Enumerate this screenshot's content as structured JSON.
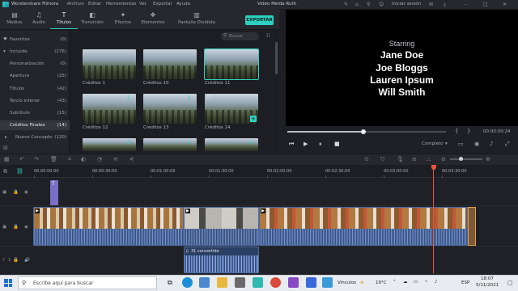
{
  "menubar": {
    "app_name": "Wondershare Filmora",
    "menus": [
      "Archivo",
      "Editar",
      "Herramientas",
      "Ver",
      "Exportar",
      "Ayuda"
    ],
    "project_title": "Video Melda Ruth",
    "login_label": "Iniciar sesión"
  },
  "tabs": [
    {
      "label": "Medios",
      "icon": "folder-icon",
      "glyph": "▤"
    },
    {
      "label": "Audio",
      "icon": "music-note-icon",
      "glyph": "♫"
    },
    {
      "label": "Títulos",
      "icon": "title-text-icon",
      "glyph": "T"
    },
    {
      "label": "Transición",
      "icon": "transition-icon",
      "glyph": "◧"
    },
    {
      "label": "Efectos",
      "icon": "effects-icon",
      "glyph": "✦"
    },
    {
      "label": "Elementos",
      "icon": "elements-icon",
      "glyph": "❖"
    },
    {
      "label": "Pantalla Dividida",
      "icon": "split-screen-icon",
      "glyph": "▥"
    }
  ],
  "export_label": "EXPORTAR",
  "search": {
    "placeholder": "Buscar"
  },
  "sidebar": {
    "items": [
      {
        "label": "Favoritos",
        "count": "(0)",
        "prefix": "♥"
      },
      {
        "label": "Incluido",
        "count": "(276)",
        "prefix": "▾"
      },
      {
        "label": "Personalización",
        "count": "(0)",
        "prefix": ""
      },
      {
        "label": "Apertura",
        "count": "(25)",
        "prefix": ""
      },
      {
        "label": "Títulos",
        "count": "(42)",
        "prefix": ""
      },
      {
        "label": "Tercio inferior",
        "count": "(43)",
        "prefix": ""
      },
      {
        "label": "Subtítulo",
        "count": "(15)",
        "prefix": ""
      },
      {
        "label": "Créditos Finales",
        "count": "(14)",
        "prefix": ""
      },
      {
        "label": "Nuevo Concepto",
        "count": "(120)",
        "prefix": "▸"
      }
    ],
    "selected_index": 7
  },
  "thumbnails": [
    {
      "caption": "Créditos 1"
    },
    {
      "caption": "Créditos 10"
    },
    {
      "caption": "Créditos 11"
    },
    {
      "caption": "Créditos 12"
    },
    {
      "caption": "Créditos 13"
    },
    {
      "caption": "Créditos 14"
    }
  ],
  "preview": {
    "credits": [
      "Starring",
      "Jane Doe",
      "Joe Bloggs",
      "Lauren Ipsum",
      "Will Smith"
    ],
    "progress": 0.48,
    "timecode": "00:00:00:24",
    "quality": "Completo"
  },
  "timeline": {
    "ruler_labels": [
      "00:00:00:00",
      "00:00:30:00",
      "00:01:00:00",
      "00:01:30:00",
      "00:02:00:00",
      "00:02:30:00",
      "00:03:00:00",
      "00:03:30:00"
    ],
    "audio_clip_label": "31 convertido",
    "track_number": "1"
  },
  "taskbar": {
    "search_placeholder": "Escribe aquí para buscar",
    "tray_app": "Vínculos",
    "weather": "19°C",
    "language": "ESP",
    "time": "18:07",
    "date": "5/11/2021"
  }
}
